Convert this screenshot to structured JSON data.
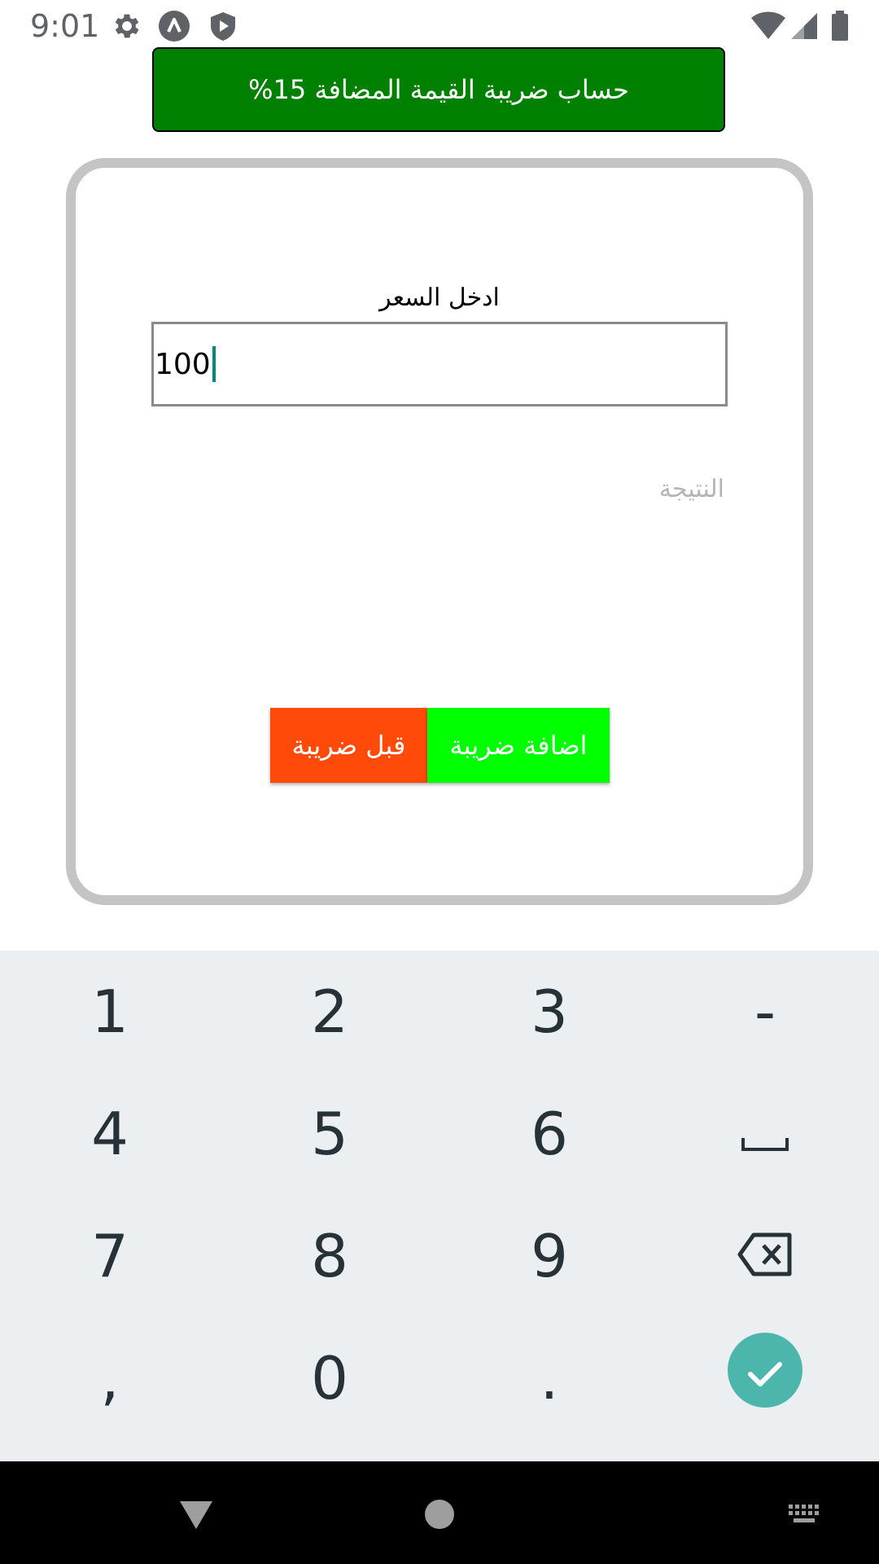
{
  "status_bar": {
    "time": "9:01",
    "icons": [
      "gear-icon",
      "app-logo-icon",
      "shield-play-icon",
      "wifi-icon",
      "signal-icon",
      "battery-icon"
    ],
    "color": "#5f6368"
  },
  "title_banner": {
    "text": "حساب ضريبة القيمة المضافة 15%",
    "background": "#008000"
  },
  "form": {
    "price_label": "ادخل السعر",
    "price_value": "100",
    "result_label": "النتيجة"
  },
  "buttons": {
    "before_tax": {
      "label": "قبل ضريبة",
      "color": "#ff4a0a"
    },
    "add_tax": {
      "label": "اضافة ضريبة",
      "color": "#00ff00"
    }
  },
  "keyboard": {
    "rows": [
      [
        "1",
        "2",
        "3",
        "-"
      ],
      [
        "4",
        "5",
        "6",
        "space"
      ],
      [
        "7",
        "8",
        "9",
        "backspace"
      ],
      [
        ",",
        "0",
        ".",
        "done"
      ]
    ],
    "done_color": "#4db6ac"
  },
  "nav_bar": {
    "items": [
      "back-icon",
      "home-icon",
      "keyboard-switch-icon"
    ]
  }
}
